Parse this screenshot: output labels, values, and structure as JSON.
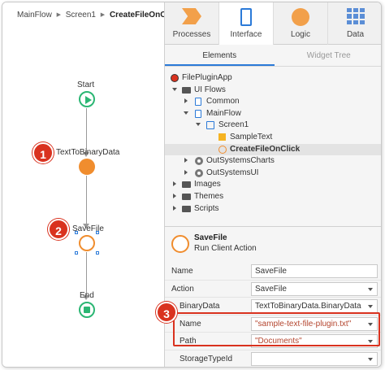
{
  "breadcrumb": {
    "items": [
      "MainFlow",
      "Screen1"
    ],
    "current": "CreateFileOnClick"
  },
  "flow": {
    "start_label": "Start",
    "node1_label": "TextToBinaryData",
    "node2_label": "SaveFile",
    "end_label": "End"
  },
  "badges": [
    "1",
    "2",
    "3"
  ],
  "tabs": [
    {
      "label": "Processes",
      "icon": "processes-icon"
    },
    {
      "label": "Interface",
      "icon": "interface-icon"
    },
    {
      "label": "Logic",
      "icon": "logic-icon"
    },
    {
      "label": "Data",
      "icon": "data-icon"
    }
  ],
  "subtabs": [
    "Elements",
    "Widget Tree"
  ],
  "tree": [
    {
      "label": "FilePluginApp",
      "icon": "app-icon"
    },
    {
      "label": "UI Flows",
      "icon": "folder-icon"
    },
    {
      "label": "Common",
      "icon": "page-icon"
    },
    {
      "label": "MainFlow",
      "icon": "page-icon"
    },
    {
      "label": "Screen1",
      "icon": "screen-icon"
    },
    {
      "label": "SampleText",
      "icon": "variable-icon"
    },
    {
      "label": "CreateFileOnClick",
      "icon": "client-action-icon"
    },
    {
      "label": "OutSystemsCharts",
      "icon": "module-icon"
    },
    {
      "label": "OutSystemsUI",
      "icon": "module-icon"
    },
    {
      "label": "Images",
      "icon": "folder-icon"
    },
    {
      "label": "Themes",
      "icon": "folder-icon"
    },
    {
      "label": "Scripts",
      "icon": "folder-icon"
    }
  ],
  "action": {
    "name": "SaveFile",
    "kind": "Run Client Action"
  },
  "props": [
    {
      "label": "Name",
      "value": "SaveFile"
    },
    {
      "label": "Action",
      "value": "SaveFile"
    },
    {
      "label": "BinaryData",
      "value": "TextToBinaryData.BinaryData"
    },
    {
      "label": "Name",
      "value": "\"sample-text-file-plugin.txt\""
    },
    {
      "label": "Path",
      "value": "\"Documents\""
    },
    {
      "label": "StorageTypeId",
      "value": ""
    }
  ],
  "colors": {
    "accent": "#2b7ad8",
    "action_orange": "#f08d2e",
    "flow_green": "#2bb673",
    "badge_red": "#d9321f"
  }
}
